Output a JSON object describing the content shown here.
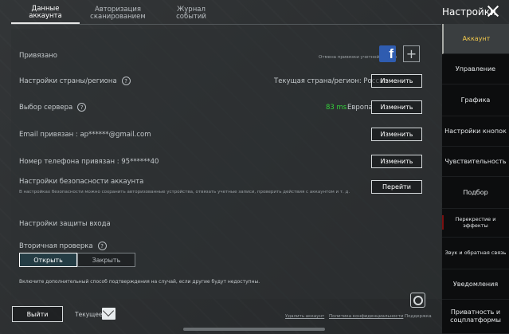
{
  "tabs": [
    {
      "label": "Данные аккаунта",
      "active": true
    },
    {
      "label": "Авторизация\nсканированием",
      "active": false
    },
    {
      "label": "Журнал событий",
      "active": false
    }
  ],
  "header": {
    "title": "Настройки"
  },
  "account": {
    "linked_label": "Привязано",
    "unlink_text": "Отмена привязки учетной записи",
    "region_label": "Настройки страны/региона",
    "region_value": "Текущая страна/регион: Россия",
    "server_label": "Выбор сервера",
    "ping_value": "83 ms",
    "server_value": "Европа",
    "email_label": "Email привязан : ap******@gmail.com",
    "phone_label": "Номер телефона привязан : 95******40",
    "security_label": "Настройки безопасности аккаунта",
    "security_desc": "В настройках безопасности можно сохранить авторизованные устройства, отвязать учетные записи, проверить действия с аккаунтом и т. д.",
    "change_button": "Изменить",
    "go_button": "Перейти"
  },
  "protection": {
    "title": "Настройки защиты входа",
    "secondary_label": "Вторичная проверка",
    "open_label": "Открыть",
    "close_label": "Закрыть",
    "note": "Включите дополнительный способ подтверждения на случай, если другие будут недоступны."
  },
  "footer": {
    "exit_label": "Выйти",
    "current_label": "Текущее",
    "delete_link": "Удалить аккаунт",
    "privacy_link": "Политика конфиденциальности",
    "support_label": "Поддержка"
  },
  "sidebar": {
    "items": [
      {
        "label": "Аккаунт",
        "active": true
      },
      {
        "label": "Управление"
      },
      {
        "label": "Графика"
      },
      {
        "label": "Настройки кнопок"
      },
      {
        "label": "Чувствительность"
      },
      {
        "label": "Подбор"
      },
      {
        "label": "Перекрестие и эффекты"
      },
      {
        "label": "Звук и обратная связь"
      },
      {
        "label": "Уведомления"
      },
      {
        "label": "Приватность и соцплатформы"
      }
    ]
  },
  "colors": {
    "ping_green": "#33d13a",
    "active_sidebar_text": "#f2c94c",
    "facebook_blue": "#2f5cb0"
  }
}
